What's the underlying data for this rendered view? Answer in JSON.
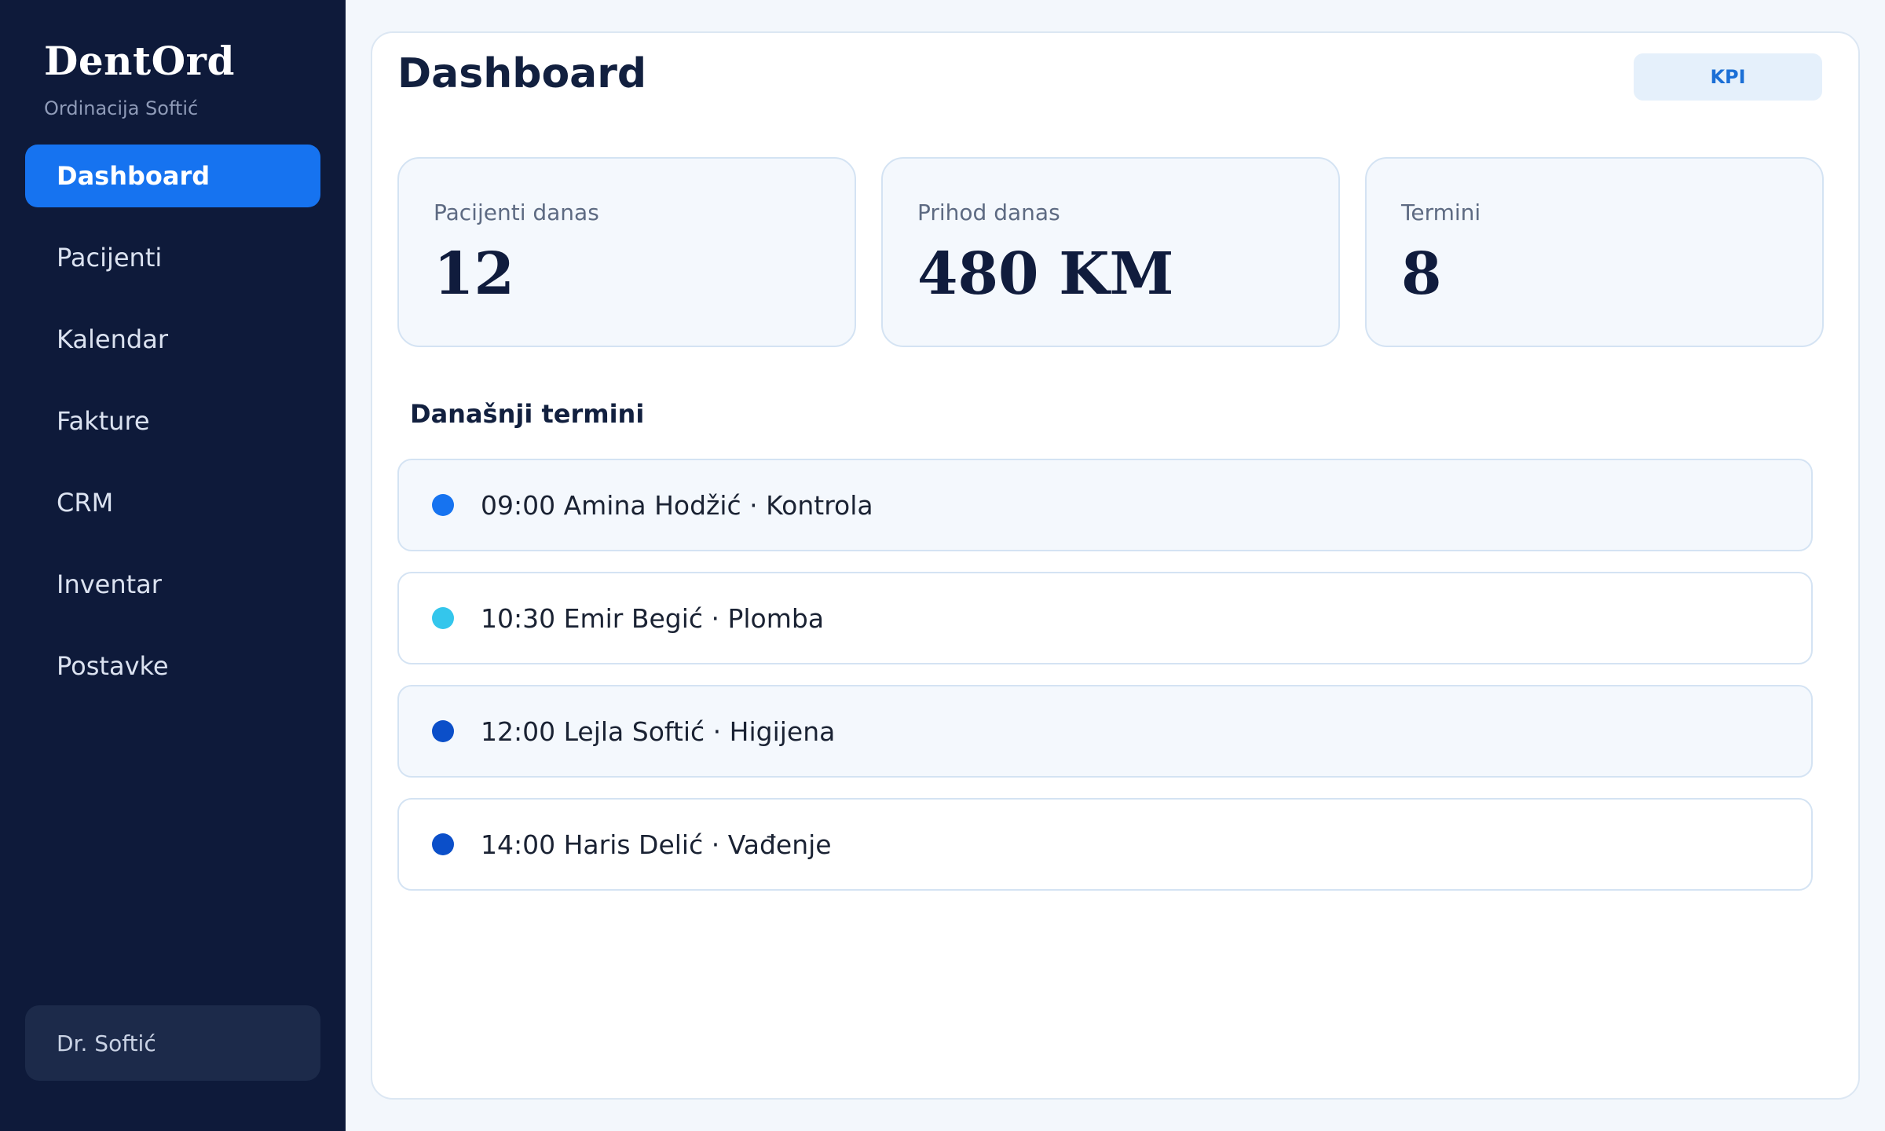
{
  "sidebar": {
    "brand": "DentOrd",
    "subtitle": "Ordinacija Softić",
    "items": [
      {
        "label": "Dashboard",
        "active": true
      },
      {
        "label": "Pacijenti"
      },
      {
        "label": "Kalendar"
      },
      {
        "label": "Fakture"
      },
      {
        "label": "CRM"
      },
      {
        "label": "Inventar"
      },
      {
        "label": "Postavke"
      }
    ],
    "user": "Dr. Softić"
  },
  "main": {
    "title": "Dashboard",
    "kpi_button": "KPI",
    "stats": [
      {
        "label": "Pacijenti danas",
        "value": "12"
      },
      {
        "label": "Prihod danas",
        "value": "480 KM"
      },
      {
        "label": "Termini",
        "value": "8"
      }
    ],
    "section_title": "Današnji termini",
    "appointments": [
      {
        "text": "09:00 Amina Hodžić · Kontrola",
        "dot_color": "#1673f0"
      },
      {
        "text": "10:30 Emir Begić · Plomba",
        "dot_color": "#34c6ec"
      },
      {
        "text": "12:00 Lejla Softić · Higijena",
        "dot_color": "#0b4fc9"
      },
      {
        "text": "14:00 Haris Delić · Vađenje",
        "dot_color": "#0b4fc9"
      }
    ]
  },
  "colors": {
    "sidebar_bg": "#0e1a3a",
    "accent": "#1673f0",
    "text_dark": "#12203f"
  }
}
